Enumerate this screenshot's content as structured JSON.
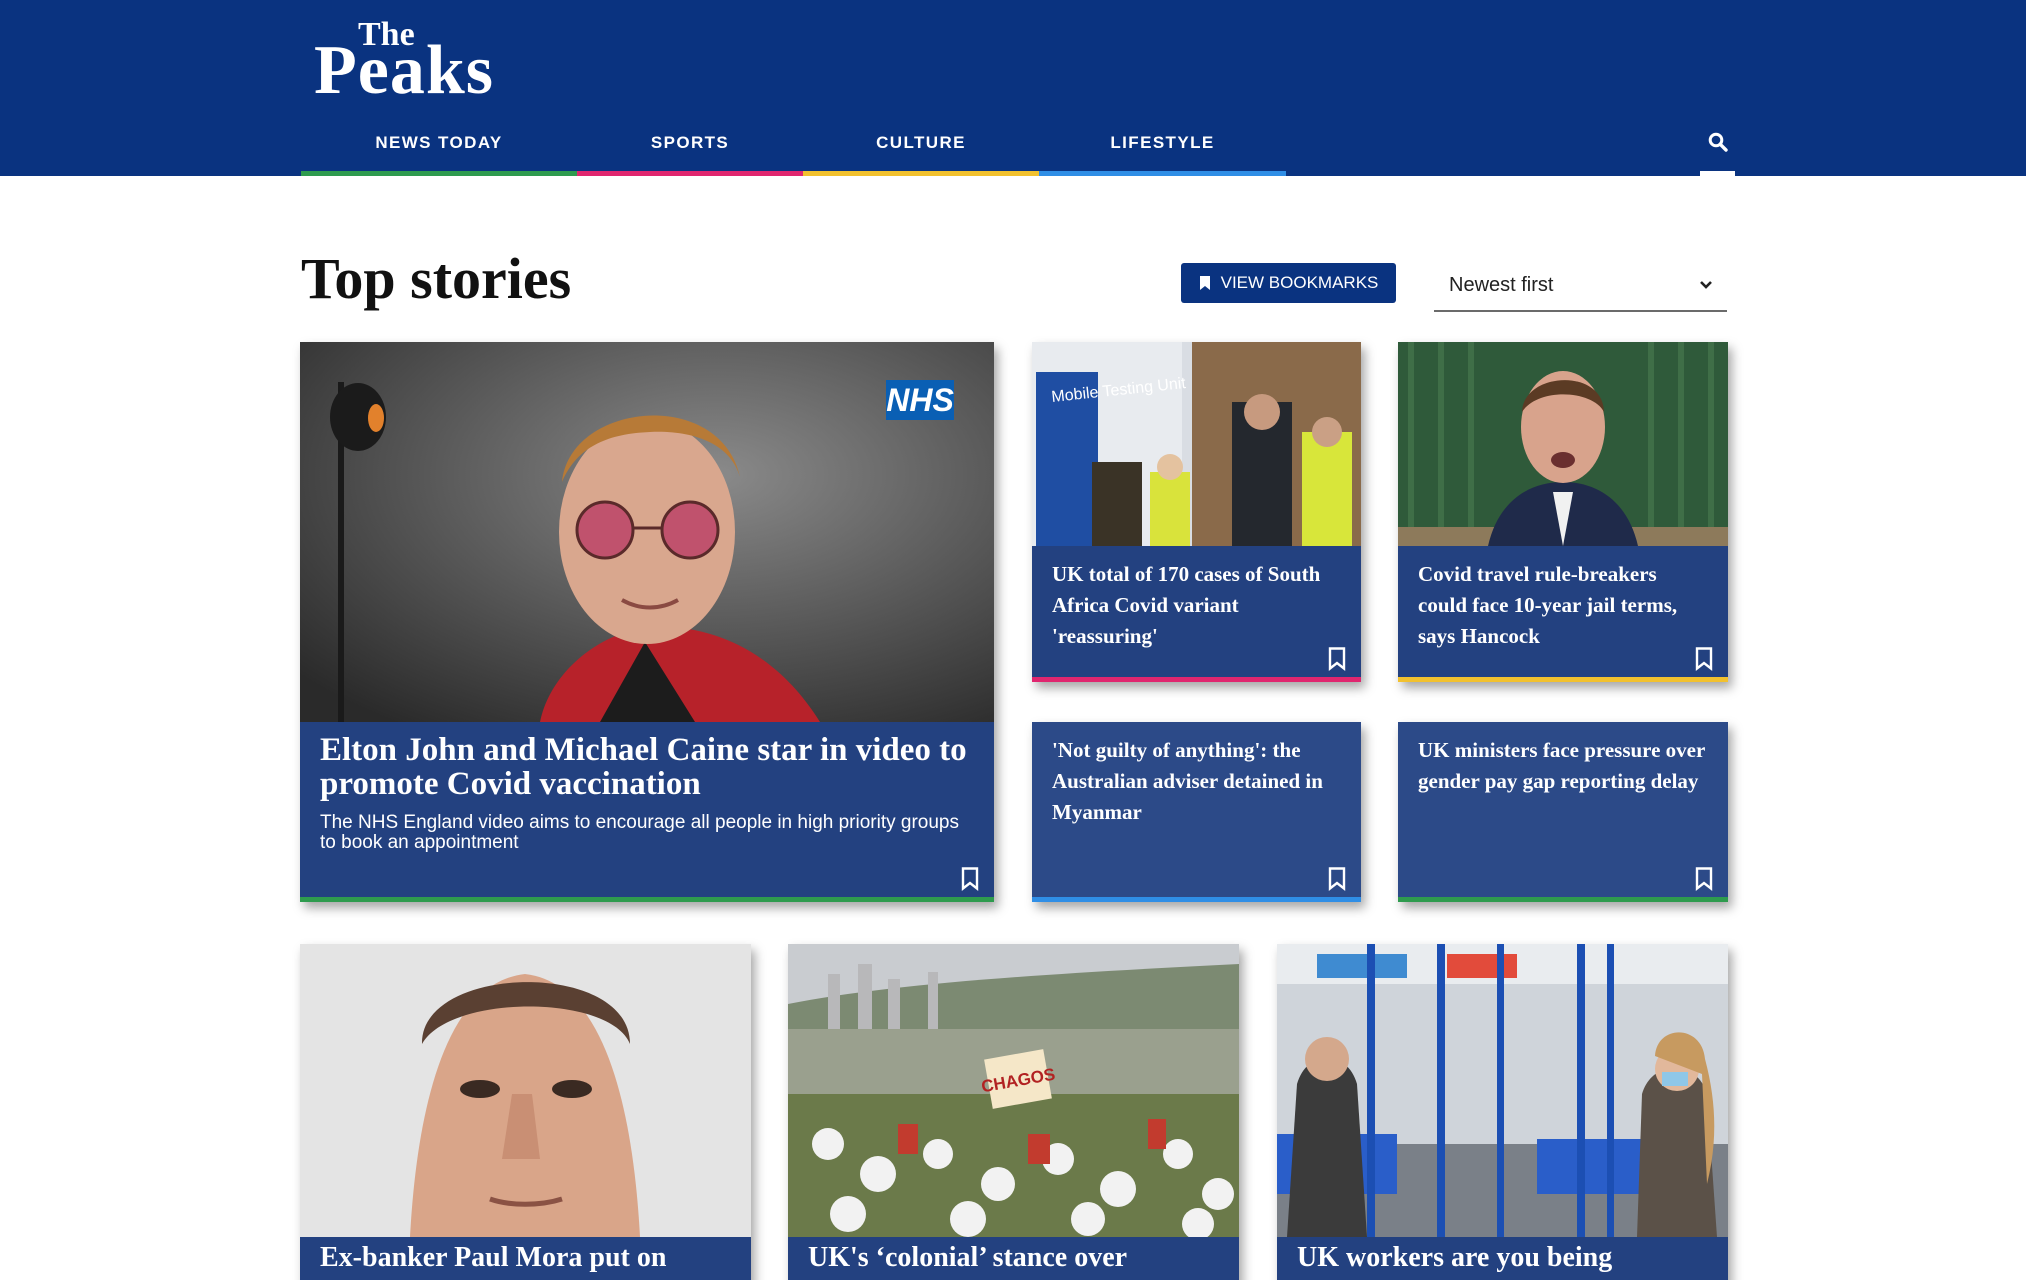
{
  "site": {
    "logo_top": "The",
    "logo_main": "Peaks"
  },
  "nav": {
    "items": [
      {
        "label": "NEWS TODAY",
        "accent": "#2e9b4e"
      },
      {
        "label": "SPORTS",
        "accent": "#e0266f"
      },
      {
        "label": "CULTURE",
        "accent": "#f2c12e"
      },
      {
        "label": "LIFESTYLE",
        "accent": "#2f8ee6"
      }
    ],
    "search_icon": "search-icon"
  },
  "section": {
    "title": "Top stories",
    "bookmarks_label": "VIEW BOOKMARKS",
    "sort_value": "Newest first"
  },
  "colors": {
    "header_bg": "#0a3380",
    "card_bg": "#233f80"
  },
  "cards": [
    {
      "headline": "Elton John and Michael Caine star in video to promote Covid vaccination",
      "summary": "The NHS England video aims to encourage all people in high priority groups to book an appointment",
      "image_badge": "NHS",
      "accent": "#2e9b4e"
    },
    {
      "headline": "UK total of 170 cases of South Africa Covid variant 'reassuring'",
      "image_text": "Mobile Testing Unit",
      "accent": "#e0266f"
    },
    {
      "headline": "Covid travel rule-breakers could face 10-year jail terms, says Hancock",
      "accent": "#f2c12e"
    },
    {
      "headline": "'Not guilty of anything': the Australian adviser detained in Myanmar",
      "accent": "#2f8ee6"
    },
    {
      "headline": "UK ministers face pressure over gender pay gap reporting delay",
      "accent": "#2e9b4e"
    },
    {
      "headline": "Ex-banker Paul Mora put on",
      "accent": "#2e9b4e"
    },
    {
      "headline": "UK's ‘colonial’ stance over",
      "image_text": "CHAGOS",
      "accent": "#2f8ee6"
    },
    {
      "headline": "UK workers are you being",
      "accent": "#f2c12e"
    }
  ]
}
